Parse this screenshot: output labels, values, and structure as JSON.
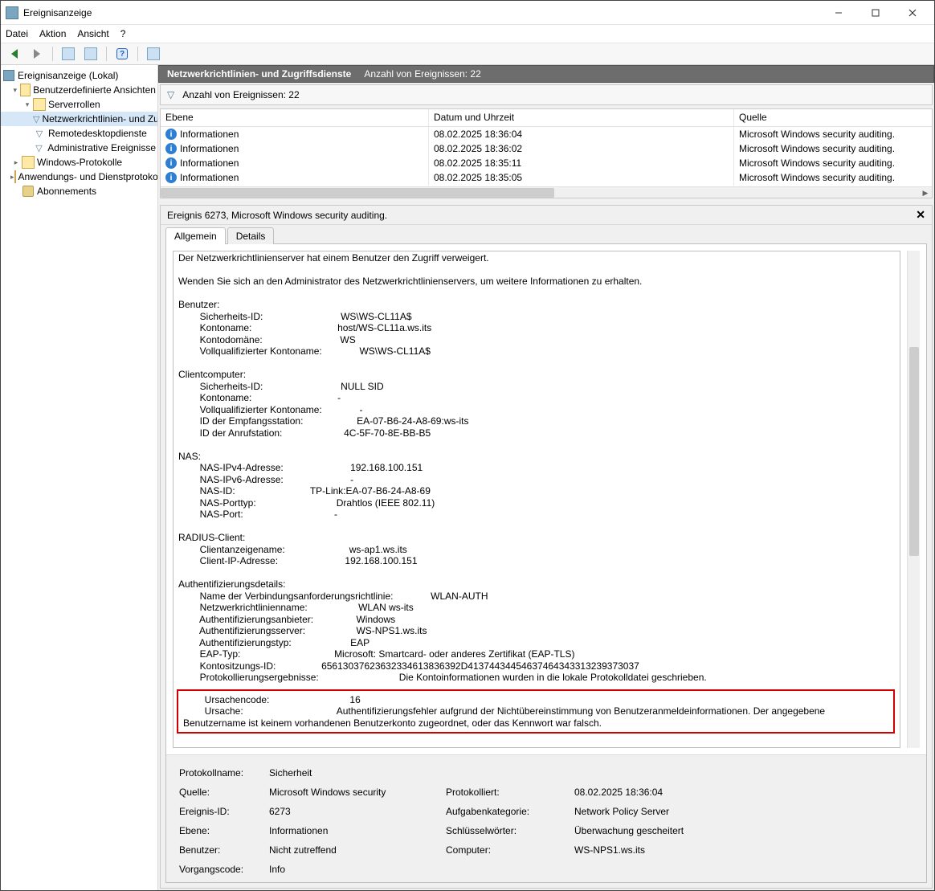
{
  "window": {
    "title": "Ereignisanzeige"
  },
  "menu": {
    "file": "Datei",
    "action": "Aktion",
    "view": "Ansicht",
    "help": "?"
  },
  "tree": {
    "root": "Ereignisanzeige (Lokal)",
    "custom_views": "Benutzerdefinierte Ansichten",
    "server_roles": "Serverrollen",
    "nps": "Netzwerkrichtlinien- und Zugriffsdienste",
    "rds": "Remotedesktopdienste",
    "admin_events": "Administrative Ereignisse",
    "win_logs": "Windows-Protokolle",
    "app_services": "Anwendungs- und Dienstprotokolle",
    "subscriptions": "Abonnements"
  },
  "category": {
    "title": "Netzwerkrichtlinien- und Zugriffsdienste",
    "count_label": "Anzahl von Ereignissen: 22"
  },
  "filterbar": {
    "count_label": "Anzahl von Ereignissen: 22"
  },
  "columns": {
    "level": "Ebene",
    "datetime": "Datum und Uhrzeit",
    "source": "Quelle"
  },
  "events": [
    {
      "level": "Informationen",
      "datetime": "08.02.2025 18:36:04",
      "source": "Microsoft Windows security auditing."
    },
    {
      "level": "Informationen",
      "datetime": "08.02.2025 18:36:02",
      "source": "Microsoft Windows security auditing."
    },
    {
      "level": "Informationen",
      "datetime": "08.02.2025 18:35:11",
      "source": "Microsoft Windows security auditing."
    },
    {
      "level": "Informationen",
      "datetime": "08.02.2025 18:35:05",
      "source": "Microsoft Windows security auditing."
    }
  ],
  "detail": {
    "title": "Ereignis 6273, Microsoft Windows security auditing.",
    "tab_general": "Allgemein",
    "tab_details": "Details",
    "body": {
      "intro1": "Der Netzwerkrichtlinienserver hat einem Benutzer den Zugriff verweigert.",
      "intro2": "Wenden Sie sich an den Administrator des Netzwerkrichtlinienservers, um weitere Informationen zu erhalten.",
      "user_header": "Benutzer:",
      "user": {
        "sid_l": "Sicherheits-ID:",
        "sid_v": "WS\\WS-CL11A$",
        "acct_l": "Kontoname:",
        "acct_v": "host/WS-CL11a.ws.its",
        "dom_l": "Kontodomäne:",
        "dom_v": "WS",
        "fqan_l": "Vollqualifizierter Kontoname:",
        "fqan_v": "WS\\WS-CL11A$"
      },
      "client_header": "Clientcomputer:",
      "client": {
        "sid_l": "Sicherheits-ID:",
        "sid_v": "NULL SID",
        "acct_l": "Kontoname:",
        "acct_v": "-",
        "fqan_l": "Vollqualifizierter Kontoname:",
        "fqan_v": "-",
        "called_l": "ID der Empfangsstation:",
        "called_v": "EA-07-B6-24-A8-69:ws-its",
        "calling_l": "ID der Anrufstation:",
        "calling_v": "4C-5F-70-8E-BB-B5"
      },
      "nas_header": "NAS:",
      "nas": {
        "ipv4_l": "NAS-IPv4-Adresse:",
        "ipv4_v": "192.168.100.151",
        "ipv6_l": "NAS-IPv6-Adresse:",
        "ipv6_v": "-",
        "id_l": "NAS-ID:",
        "id_v": "TP-Link:EA-07-B6-24-A8-69",
        "ptype_l": "NAS-Porttyp:",
        "ptype_v": "Drahtlos (IEEE 802.11)",
        "port_l": "NAS-Port:",
        "port_v": "-"
      },
      "radius_header": "RADIUS-Client:",
      "radius": {
        "fname_l": "Clientanzeigename:",
        "fname_v": "ws-ap1.ws.its",
        "ip_l": "Client-IP-Adresse:",
        "ip_v": "192.168.100.151"
      },
      "auth_header": "Authentifizierungsdetails:",
      "auth": {
        "crp_l": "Name der Verbindungsanforderungsrichtlinie:",
        "crp_v": "WLAN-AUTH",
        "np_l": "Netzwerkrichtlinienname:",
        "np_v": "WLAN ws-its",
        "prov_l": "Authentifizierungsanbieter:",
        "prov_v": "Windows",
        "srv_l": "Authentifizierungsserver:",
        "srv_v": "WS-NPS1.ws.its",
        "type_l": "Authentifizierungstyp:",
        "type_v": "EAP",
        "eap_l": "EAP-Typ:",
        "eap_v": "Microsoft: Smartcard- oder anderes Zertifikat (EAP-TLS)",
        "sess_l": "Kontositzungs-ID:",
        "sess_v": "65613037623632334613836392D41374434454637464343313239373037",
        "log_l": "Protokollierungsergebnisse:",
        "log_v": "Die Kontoinformationen wurden in die lokale Protokolldatei geschrieben."
      },
      "reason": {
        "code_l": "Ursachencode:",
        "code_v": "16",
        "reason_l": "Ursache:",
        "reason_v": "Authentifizierungsfehler aufgrund der Nichtübereinstimmung von Benutzeranmeldeinformationen. Der angegebene",
        "reason_v2": "Benutzername ist keinem vorhandenen Benutzerkonto zugeordnet, oder das Kennwort war falsch."
      }
    },
    "summary": {
      "log_l": "Protokollname:",
      "log_v": "Sicherheit",
      "src_l": "Quelle:",
      "src_v": "Microsoft Windows security",
      "logged_l": "Protokolliert:",
      "logged_v": "08.02.2025 18:36:04",
      "eid_l": "Ereignis-ID:",
      "eid_v": "6273",
      "cat_l": "Aufgabenkategorie:",
      "cat_v": "Network Policy Server",
      "lvl_l": "Ebene:",
      "lvl_v": "Informationen",
      "kw_l": "Schlüsselwörter:",
      "kw_v": "Überwachung gescheitert",
      "usr_l": "Benutzer:",
      "usr_v": "Nicht zutreffend",
      "cmp_l": "Computer:",
      "cmp_v": "WS-NPS1.ws.its",
      "op_l": "Vorgangscode:",
      "op_v": "Info"
    }
  }
}
